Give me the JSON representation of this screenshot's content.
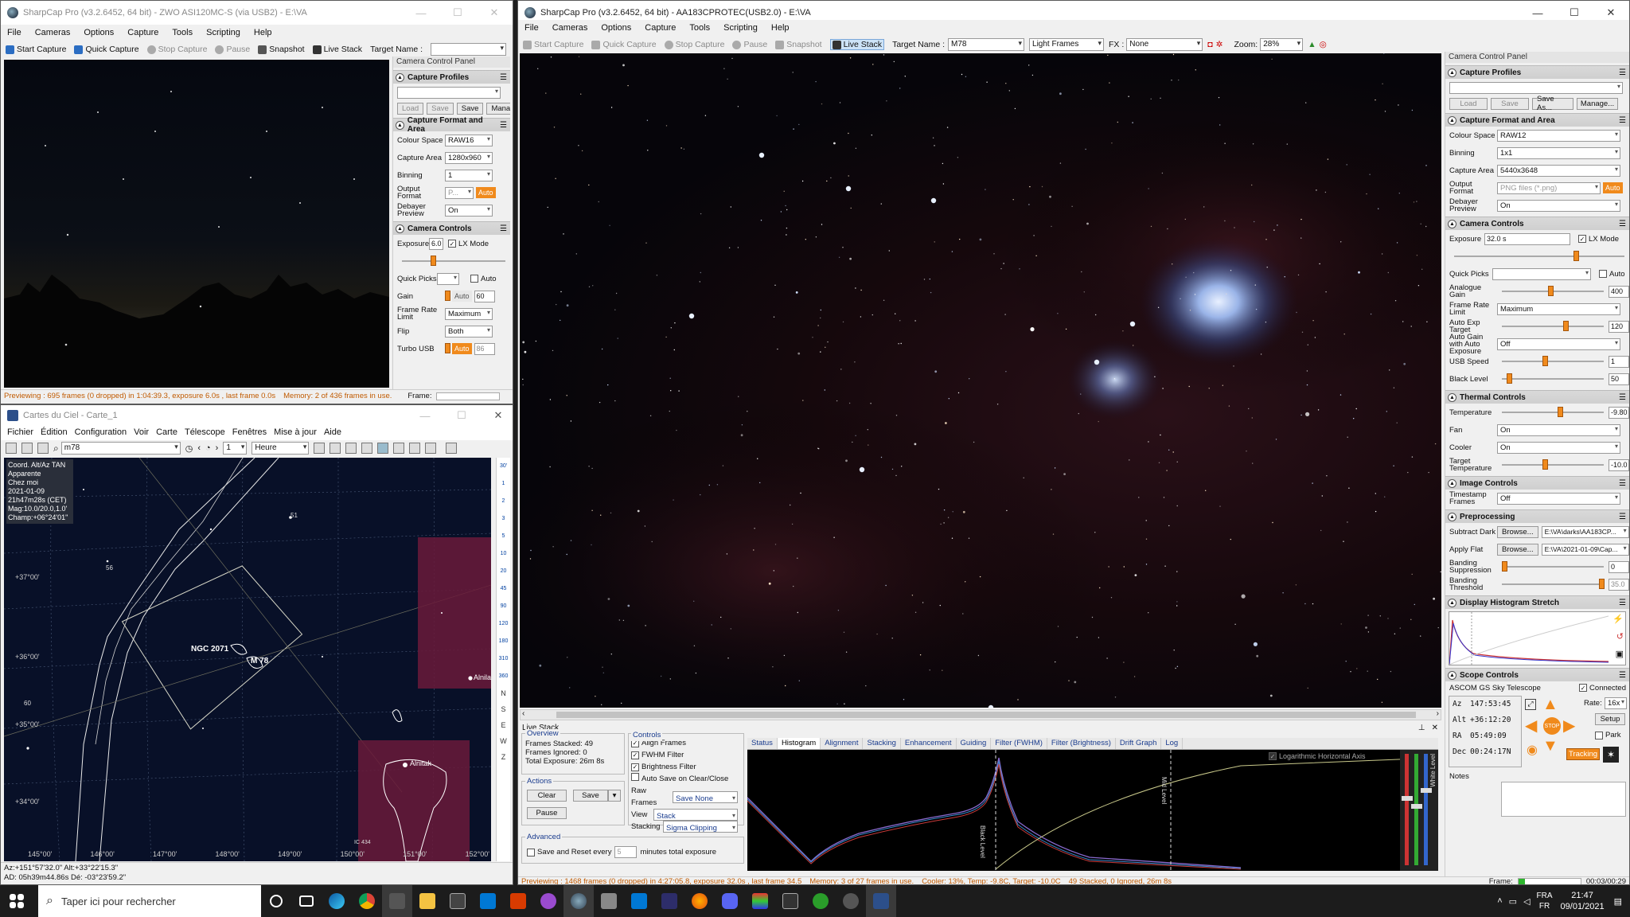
{
  "colors": {
    "accent": "#f08a1c",
    "status_text": "#c05a00",
    "sky": "#081028",
    "chart_highlight": "#6a1a3a"
  },
  "sharpcap_small": {
    "title": "SharpCap Pro (v3.2.6452, 64 bit) - ZWO ASI120MC-S (via USB2) - E:\\VA",
    "menu": [
      "File",
      "Cameras",
      "Options",
      "Capture",
      "Tools",
      "Scripting",
      "Help"
    ],
    "toolbar": {
      "start": "Start Capture",
      "quick": "Quick Capture",
      "stop": "Stop Capture",
      "pause": "Pause",
      "snapshot": "Snapshot",
      "live": "Live Stack",
      "target_label": "Target Name :"
    },
    "panel_title": "Camera Control Panel",
    "capture_profiles": "Capture Profiles",
    "profile_buttons": [
      "Load",
      "Save",
      "Save",
      "Manage"
    ],
    "capture_format": "Capture Format and Area",
    "format_rows": [
      {
        "label": "Colour Space",
        "value": "RAW16"
      },
      {
        "label": "Capture Area",
        "value": "1280x960"
      },
      {
        "label": "Binning",
        "value": "1"
      },
      {
        "label": "Output Format",
        "value": "P..."
      },
      {
        "label": "Debayer Preview",
        "value": "On"
      }
    ],
    "camera_controls": "Camera Controls",
    "exposure_label": "Exposure",
    "exposure_value": "6.0",
    "lx_mode": "LX Mode",
    "quick_picks": "Quick Picks",
    "auto": "Auto",
    "gain_label": "Gain",
    "gain_value": "60",
    "frame_rate_label": "Frame Rate Limit",
    "frame_rate_value": "Maximum",
    "flip_label": "Flip",
    "flip_value": "Both",
    "turbo_label": "Turbo USB",
    "turbo_value": "86",
    "status_preview": "Previewing : 695 frames (0 dropped) in 1:04:39.3, exposure 6.0s , last frame 0.0s",
    "status_memory": "Memory: 2 of 436 frames in use.",
    "status_frame": "Frame:"
  },
  "cdc": {
    "title": "Cartes du Ciel - Carte_1",
    "menu": [
      "Fichier",
      "Édition",
      "Configuration",
      "Voir",
      "Carte",
      "Télescope",
      "Fenêtres",
      "Mise à jour",
      "Aide"
    ],
    "search_value": "m78",
    "step_value": "1",
    "time_unit": "Heure",
    "info": [
      "Coord. Alt/Az TAN",
      "Apparente",
      "Chez moi",
      "2021-01-09",
      "21h47m28s (CET)",
      "Mag:10.0/20.0,1.0'",
      "Champ:+06°24'01\""
    ],
    "labels": {
      "ngc": "NGC 2071",
      "m78": "M 78",
      "alnilam": "Alnilam",
      "alnitak": "Alnitak",
      "ic": "IC 434",
      "n51": "51",
      "n56": "56",
      "n60": "60"
    },
    "dec_labels": [
      "+37°00'",
      "+36°00'",
      "+35°00'",
      "+34°00'"
    ],
    "ra_labels": [
      "145°00'",
      "146°00'",
      "147°00'",
      "148°00'",
      "149°00'",
      "150°00'",
      "151°00'",
      "152°00'"
    ],
    "scale": [
      "30'",
      "1",
      "2",
      "3",
      "5",
      "10",
      "20",
      "45",
      "90",
      "120",
      "180",
      "310",
      "360"
    ],
    "dirs": [
      "N",
      "S",
      "E",
      "W",
      "Z"
    ],
    "status1": "Az:+151°57'32.0\" Alt:+33°22'15.3\"",
    "status2": "AD: 05h39m44.86s Dé: -03°23'59.2\""
  },
  "sharpcap_main": {
    "title": "SharpCap Pro (v3.2.6452, 64 bit) - AA183CPROTEC(USB2.0) - E:\\VA",
    "menu": [
      "File",
      "Cameras",
      "Options",
      "Capture",
      "Tools",
      "Scripting",
      "Help"
    ],
    "toolbar": {
      "start": "Start Capture",
      "quick": "Quick Capture",
      "stop": "Stop Capture",
      "pause": "Pause",
      "snapshot": "Snapshot",
      "live": "Live Stack",
      "target_label": "Target Name :",
      "target_value": "M78",
      "frame_type": "Light Frames",
      "fx_label": "FX :",
      "fx_value": "None",
      "zoom_label": "Zoom:",
      "zoom_value": "28%"
    },
    "panel_title": "Camera Control Panel",
    "capture_profiles": "Capture Profiles",
    "profile_buttons": [
      "Load",
      "Save",
      "Save As...",
      "Manage..."
    ],
    "capture_format": "Capture Format and Area",
    "format_rows": [
      {
        "label": "Colour Space",
        "value": "RAW12"
      },
      {
        "label": "Binning",
        "value": "1x1"
      },
      {
        "label": "Capture Area",
        "value": "5440x3648"
      },
      {
        "label": "Output Format",
        "value": "PNG files (*.png)"
      },
      {
        "label": "Debayer Preview",
        "value": "On"
      }
    ],
    "camera_controls": "Camera Controls",
    "exposure_label": "Exposure",
    "exposure_value": "32.0 s",
    "lx_mode": "LX Mode",
    "quick_picks": "Quick Picks",
    "auto": "Auto",
    "sliders": [
      {
        "label": "Analogue Gain",
        "value": "400",
        "pos": 0.45
      },
      {
        "label": "Frame Rate Limit",
        "value": "Maximum",
        "type": "combo"
      },
      {
        "label": "Auto Exp Target",
        "value": "120",
        "pos": 0.6
      },
      {
        "label": "Auto Gain with Auto Exposure",
        "value": "Off",
        "type": "combo"
      },
      {
        "label": "USB Speed",
        "value": "1",
        "pos": 0.4
      },
      {
        "label": "Black Level",
        "value": "50",
        "pos": 0.05
      }
    ],
    "thermal": "Thermal Controls",
    "thermal_rows": [
      {
        "label": "Temperature",
        "value": "-9.80",
        "pos": 0.55
      },
      {
        "label": "Fan",
        "value": "On",
        "type": "combo"
      },
      {
        "label": "Cooler",
        "value": "On",
        "type": "combo"
      },
      {
        "label": "Target Temperature",
        "value": "-10.0",
        "pos": 0.4
      }
    ],
    "image_controls": "Image Controls",
    "timestamp_label": "Timestamp Frames",
    "timestamp_value": "Off",
    "preprocessing": "Preprocessing",
    "subtract_dark": "Subtract Dark",
    "dark_path": "E:\\VA\\darks\\AA183CP...",
    "apply_flat": "Apply Flat",
    "flat_path": "E:\\VA\\2021-01-09\\Cap...",
    "browse": "Browse...",
    "banding_supp": "Banding Suppression",
    "banding_supp_value": "0",
    "banding_thr": "Banding Threshold",
    "banding_thr_value": "35.0",
    "histogram_stretch": "Display Histogram Stretch",
    "scope": "Scope Controls",
    "scope_name": "ASCOM GS Sky Telescope",
    "connected": "Connected",
    "az_label": "Az",
    "az_value": "147:53:45",
    "alt_label": "Alt",
    "alt_value": "+36:12:20",
    "ra_label": "RA",
    "ra_value": "05:49:09",
    "dec_label": "Dec",
    "dec_value": "00:24:17N",
    "rate_label": "Rate:",
    "rate_value": "16x",
    "setup": "Setup",
    "park": "Park",
    "tracking": "Tracking",
    "stop": "STOP",
    "notes": "Notes",
    "status_preview": "Previewing : 1468 frames (0 dropped) in 4:27:05.8, exposure 32.0s , last frame 34.5",
    "status_memory": "Memory: 3 of 27 frames in use.",
    "status_cooler": "Cooler: 13%, Temp: -9.8C, Target: -10.0C",
    "status_stacked": "49 Stacked, 0 Ignored, 26m 8s",
    "status_frame": "Frame:",
    "status_time": "00:03/00:29"
  },
  "live_stack": {
    "title": "Live Stack",
    "overview": "Overview",
    "frames_stacked_label": "Frames Stacked:",
    "frames_stacked": "49",
    "frames_ignored_label": "Frames Ignored:",
    "frames_ignored": "0",
    "total_exposure_label": "Total Exposure:",
    "total_exposure": "26m 8s",
    "actions": "Actions",
    "clear": "Clear",
    "save": "Save",
    "pause": "Pause",
    "controls": "Controls",
    "checks": [
      "Align Frames",
      "FWHM Filter",
      "Brightness Filter",
      "Auto Save on Clear/Close"
    ],
    "raw_frames_label": "Raw Frames",
    "raw_frames_value": "Save None",
    "view_label": "View",
    "view_value": "Stack",
    "stacking_label": "Stacking",
    "stacking_value": "Sigma Clipping",
    "advanced": "Advanced",
    "save_reset": "Save and Reset every",
    "save_reset_value": "5",
    "minutes": "minutes total exposure",
    "tabs": [
      "Status",
      "Histogram",
      "Alignment",
      "Stacking",
      "Enhancement",
      "Guiding",
      "Filter (FWHM)",
      "Filter (Brightness)",
      "Drift Graph",
      "Log"
    ],
    "active_tab": "Histogram",
    "log_axis": "Logarithmic Horizontal Axis",
    "black_level": "Black Level",
    "mid_level": "Mid Level",
    "white_level": "White Level"
  },
  "taskbar": {
    "search": "Taper ici pour rechercher",
    "lang1": "FRA",
    "lang2": "FR",
    "time": "21:47",
    "date": "09/01/2021"
  }
}
